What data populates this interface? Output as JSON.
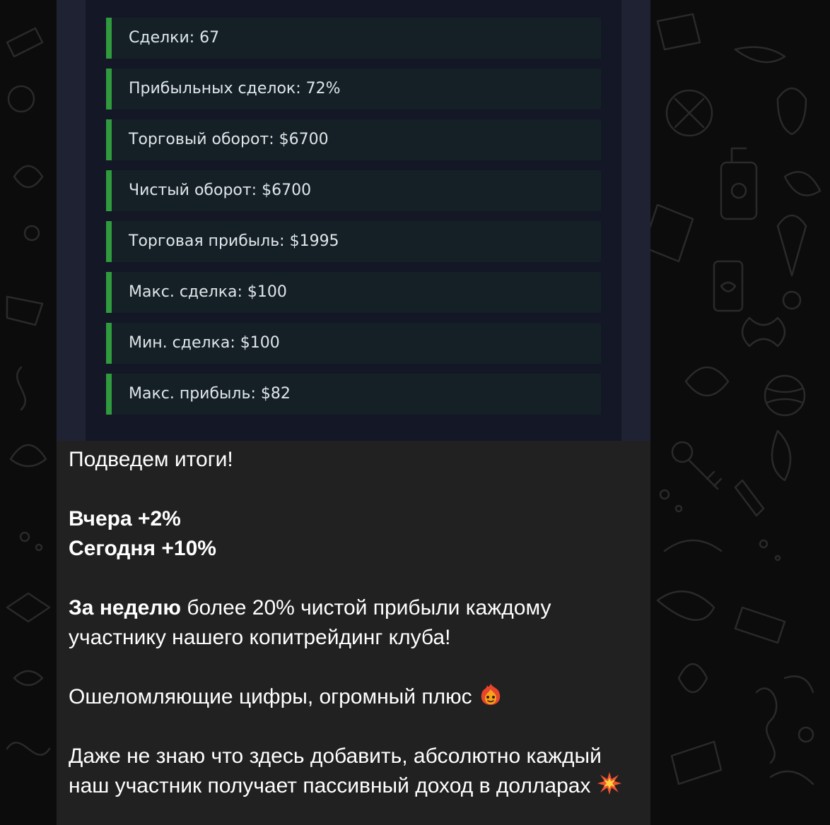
{
  "stats": [
    {
      "label": "Сделки: 67"
    },
    {
      "label": "Прибыльных сделок: 72%"
    },
    {
      "label": "Торговый оборот: $6700"
    },
    {
      "label": "Чистый оборот: $6700"
    },
    {
      "label": "Торговая прибыль: $1995"
    },
    {
      "label": "Макс. сделка: $100"
    },
    {
      "label": "Мин. сделка: $100"
    },
    {
      "label": "Макс. прибыль: $82"
    }
  ],
  "message": {
    "line_summary": "Подведем итоги!",
    "line_yesterday": "Вчера +2%",
    "line_today": "Сегодня +10%",
    "week_bold": "За неделю",
    "week_rest": " более 20% чистой прибыли каждому участнику нашего копитрейдинг клуба!",
    "amazing": "Ошеломляющие цифры, огромный плюс ",
    "closing": "Даже не знаю что здесь добавить, абсолютно каждый наш участник получает пассивный доход в долларах ",
    "amazing_emoji_icon": "fire-face-icon",
    "closing_emoji_icon": "collision-icon"
  },
  "colors": {
    "accent_green": "#2f9b3d",
    "bubble_bg": "#212121",
    "panel_bg": "#131726"
  }
}
